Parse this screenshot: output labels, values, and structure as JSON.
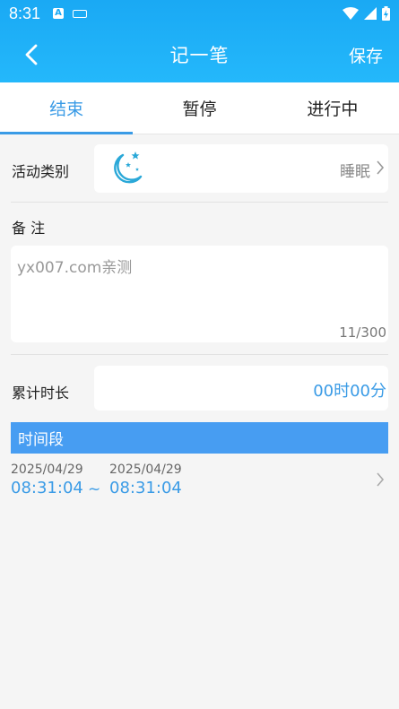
{
  "status_bar": {
    "time": "8:31",
    "app_badge": "A"
  },
  "nav": {
    "title": "记一笔",
    "save_label": "保存"
  },
  "tabs": [
    {
      "label": "结束",
      "active": true
    },
    {
      "label": "暂停",
      "active": false
    },
    {
      "label": "进行中",
      "active": false
    }
  ],
  "activity": {
    "label": "活动类别",
    "icon": "moon-stars-icon",
    "value": "睡眠"
  },
  "note": {
    "label": "备 注",
    "value": "yx007.com亲测",
    "counter": "11/300"
  },
  "duration": {
    "label": "累计时长",
    "value": "00时00分"
  },
  "period": {
    "header": "时间段",
    "start_date": "2025/04/29",
    "start_time": "08:31:04",
    "separator": "~",
    "end_date": "2025/04/29",
    "end_time": "08:31:04"
  },
  "colors": {
    "header": "#1aa9f4",
    "accent": "#3a9be6",
    "period_header": "#479df2"
  }
}
